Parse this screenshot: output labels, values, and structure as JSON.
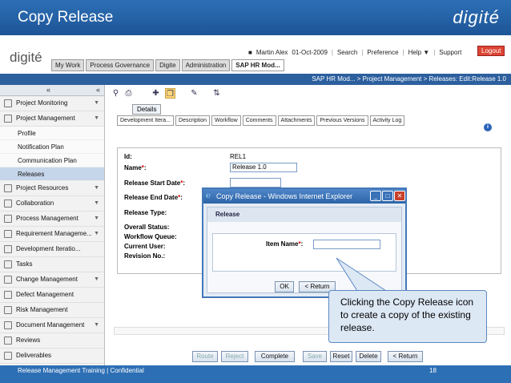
{
  "slide": {
    "title": "Copy Release",
    "brand": "digité",
    "footer_left": "Release Management Training |  Confidential",
    "page_number": "18"
  },
  "app": {
    "logo": "digité",
    "user": "Martin Alex",
    "date": "01-Oct-2009",
    "links": [
      "Search",
      "Preference",
      "Help ▼",
      "Support"
    ],
    "logout": "Logout",
    "main_tabs": [
      "My Work",
      "Process Governance",
      "Digite",
      "Administration",
      "SAP HR Mod..."
    ],
    "breadcrumb": "SAP HR Mod... > Project Management > Releases: Edit:Release 1.0"
  },
  "sidebar": {
    "items": [
      {
        "label": "Project Monitoring",
        "arrow": "▼"
      },
      {
        "label": "Project Management",
        "arrow": "▼"
      }
    ],
    "subitems": [
      "Profile",
      "Notification Plan",
      "Communication Plan",
      "Releases"
    ],
    "active_subitem": "Releases",
    "items_after": [
      {
        "label": "Project Resources",
        "arrow": "▼"
      },
      {
        "label": "Collaboration",
        "arrow": "▼"
      },
      {
        "label": "Process Management",
        "arrow": "▼"
      },
      {
        "label": "Requirement Manageme...",
        "arrow": "▼"
      },
      {
        "label": "Development Iteratio...",
        "arrow": ""
      },
      {
        "label": "Tasks",
        "arrow": ""
      },
      {
        "label": "Change Management",
        "arrow": "▼"
      },
      {
        "label": "Defect Management",
        "arrow": ""
      },
      {
        "label": "Risk Management",
        "arrow": ""
      },
      {
        "label": "Document Management",
        "arrow": "▼"
      },
      {
        "label": "Reviews",
        "arrow": ""
      },
      {
        "label": "Deliverables",
        "arrow": ""
      }
    ]
  },
  "content": {
    "details_tab": "Details",
    "sub_tabs": [
      "Development Itera...",
      "Description",
      "Workflow",
      "Comments",
      "Attachments",
      "Previous Versions",
      "Activity Log"
    ],
    "fields": {
      "id_label": "Id:",
      "id_value": "REL1",
      "name_label": "Name",
      "name_value": "Release 1.0",
      "start_label": "Release Start Date",
      "end_label": "Release End Date",
      "type_label": "Release Type:",
      "status_label": "Overall Status:",
      "queue_label": "Workflow Queue:",
      "user_label": "Current User:",
      "revision_label": "Revision No.:"
    },
    "buttons": [
      "Route",
      "Reject",
      "Complete",
      "Save",
      "Reset",
      "Delete",
      "< Return"
    ]
  },
  "popup": {
    "title": "Copy Release - Windows Internet Explorer",
    "header": "Release",
    "item_label": "Item Name",
    "ok": "OK",
    "return": "< Return"
  },
  "callout": {
    "text": "Clicking the Copy Release icon to create a copy of the existing release."
  },
  "colors": {
    "slide_blue": "#2d6fb5",
    "breadcrumb_bar": "#2c5f9e",
    "active_nav": "#c6d6ea",
    "callout_fill": "#dde8f5"
  }
}
